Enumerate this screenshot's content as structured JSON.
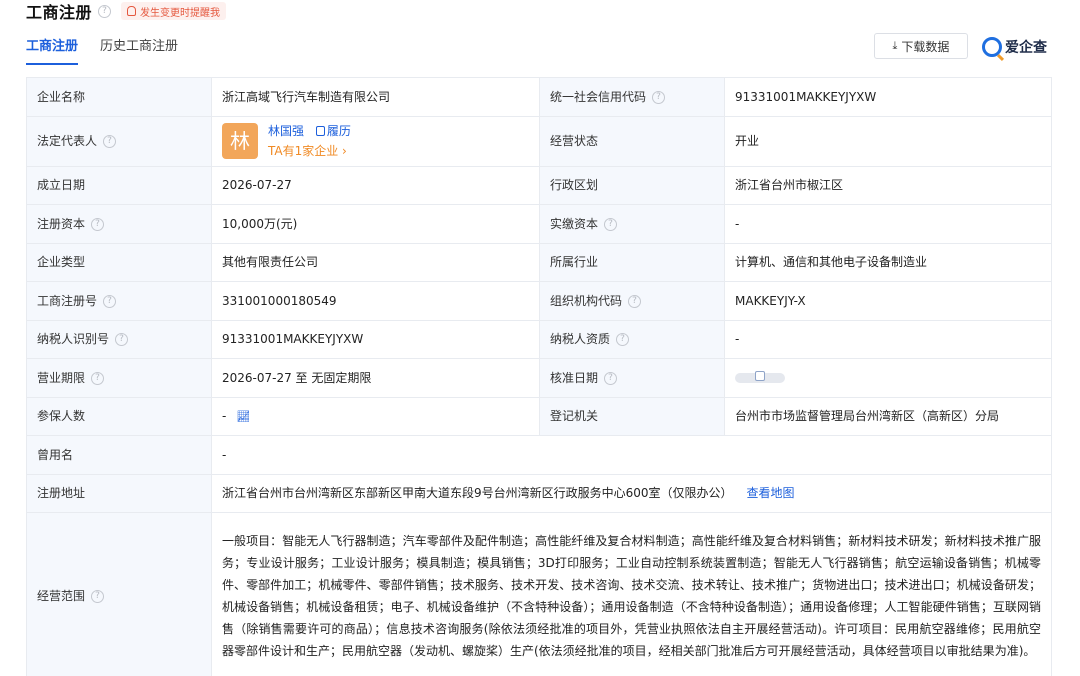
{
  "header": {
    "title": "工商注册",
    "notify_label": "发生变更时提醒我",
    "tabs": [
      {
        "label": "工商注册"
      },
      {
        "label": "历史工商注册"
      }
    ],
    "download_label": "下载数据",
    "brand_name": "爱企查"
  },
  "rows": {
    "company_name": {
      "label": "企业名称",
      "value": "浙江高域飞行汽车制造有限公司"
    },
    "credit_code": {
      "label": "统一社会信用代码",
      "value": "91331001MAKKEYJYXW"
    },
    "legal_rep": {
      "label": "法定代表人",
      "avatar_char": "林",
      "name": "林国强",
      "resume": "履历",
      "sub": "TA有1家企业 ›"
    },
    "status": {
      "label": "经营状态",
      "value": "开业"
    },
    "found_date": {
      "label": "成立日期",
      "value": "2026-07-27"
    },
    "region": {
      "label": "行政区划",
      "value": "浙江省台州市椒江区"
    },
    "reg_capital": {
      "label": "注册资本",
      "value": "10,000万(元)"
    },
    "paid_capital": {
      "label": "实缴资本",
      "value": "-"
    },
    "company_type": {
      "label": "企业类型",
      "value": "其他有限责任公司"
    },
    "industry": {
      "label": "所属行业",
      "value": "计算机、通信和其他电子设备制造业"
    },
    "reg_no": {
      "label": "工商注册号",
      "value": "331001000180549"
    },
    "org_code": {
      "label": "组织机构代码",
      "value": "MAKKEYJY-X"
    },
    "taxpayer_id": {
      "label": "纳税人识别号",
      "value": "91331001MAKKEYJYXW"
    },
    "taxpayer_qual": {
      "label": "纳税人资质",
      "value": "-"
    },
    "business_term": {
      "label": "营业期限",
      "value": "2026-07-27 至 无固定期限"
    },
    "approval_date": {
      "label": "核准日期"
    },
    "insured": {
      "label": "参保人数",
      "value": "-"
    },
    "authority": {
      "label": "登记机关",
      "value": "台州市市场监督管理局台州湾新区（高新区）分局"
    },
    "former_name": {
      "label": "曾用名",
      "value": "-"
    },
    "address": {
      "label": "注册地址",
      "value": "浙江省台州市台州湾新区东部新区甲南大道东段9号台州湾新区行政服务中心600室（仅限办公）",
      "map_link": "查看地图"
    },
    "scope": {
      "label": "经营范围",
      "value": "一般项目：智能无人飞行器制造；汽车零部件及配件制造；高性能纤维及复合材料制造；高性能纤维及复合材料销售；新材料技术研发；新材料技术推广服务；专业设计服务；工业设计服务；模具制造；模具销售；3D打印服务；工业自动控制系统装置制造；智能无人飞行器销售；航空运输设备销售；机械零件、零部件加工；机械零件、零部件销售；技术服务、技术开发、技术咨询、技术交流、技术转让、技术推广；货物进出口；技术进出口；机械设备研发；机械设备销售；机械设备租赁；电子、机械设备维护（不含特种设备）；通用设备制造（不含特种设备制造）；通用设备修理；人工智能硬件销售；互联网销售（除销售需要许可的商品）；信息技术咨询服务(除依法须经批准的项目外，凭营业执照依法自主开展经营活动)。许可项目：民用航空器维修；民用航空器零部件设计和生产；民用航空器（发动机、螺旋桨）生产(依法须经批准的项目，经相关部门批准后方可开展经营活动，具体经营项目以审批结果为准)。"
    }
  }
}
